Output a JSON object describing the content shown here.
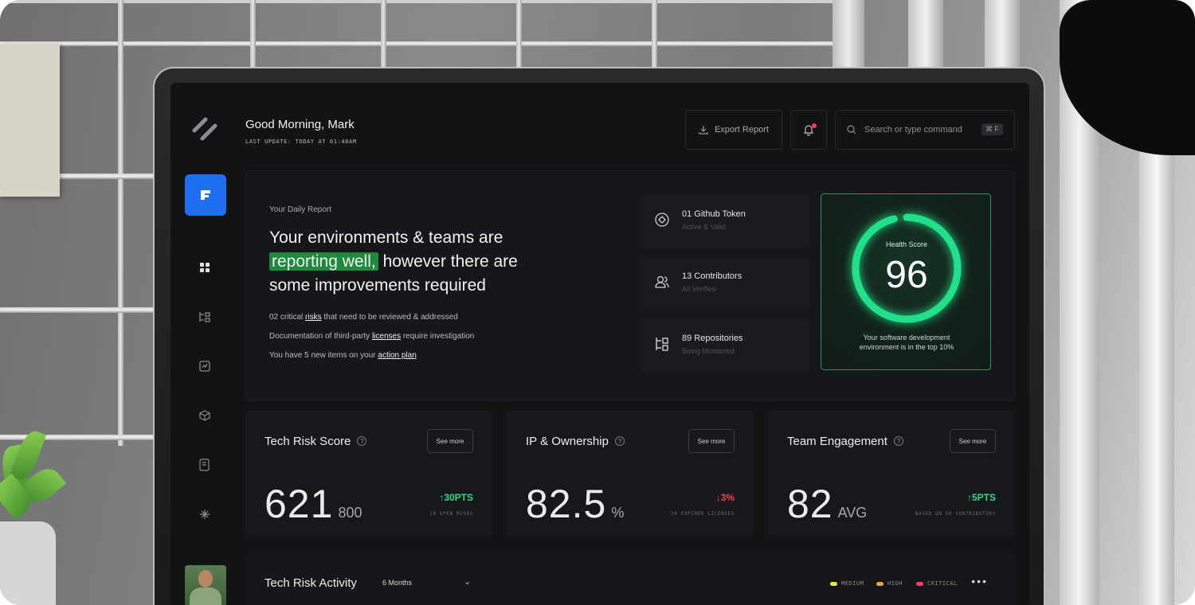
{
  "header": {
    "greeting": "Good Morning, Mark",
    "last_update": "LAST UPDATE: TODAY AT 01:48AM",
    "export_label": "Export Report",
    "search_placeholder": "Search or type command",
    "search_shortcut": "⌘ F"
  },
  "report": {
    "label": "Your Daily Report",
    "headline_pre": "Your environments & teams are",
    "headline_highlight": "reporting well,",
    "headline_post": "however there are some improvements required",
    "lines": [
      {
        "pre": "02 critical ",
        "link": "risks",
        "post": " that need to be reviewed & addressed"
      },
      {
        "pre": "Documentation of third-party ",
        "link": "licenses",
        "post": " require investigation"
      },
      {
        "pre": "You have 5 new items on your ",
        "link": "action plan",
        "post": ""
      }
    ]
  },
  "stats": [
    {
      "title": "01 Github Token",
      "subtitle": "Active & Valid",
      "icon": "token-icon"
    },
    {
      "title": "13 Contributors",
      "subtitle": "All Verified",
      "icon": "users-icon"
    },
    {
      "title": "89 Repositories",
      "subtitle": "Being Monitored",
      "icon": "repo-icon"
    }
  ],
  "health": {
    "label": "Health Score",
    "score": "96",
    "score_fraction": 0.96,
    "description": "Your software development environment is in the top 10%",
    "accent": "#22e08a"
  },
  "cards": [
    {
      "title": "Tech Risk Score",
      "more": "See more",
      "value": "621",
      "unit": "800",
      "delta": "30PTS",
      "direction": "up",
      "note": "20 OPEN RISKS"
    },
    {
      "title": "IP & Ownership",
      "more": "See more",
      "value": "82.5",
      "unit": "%",
      "delta": "3%",
      "direction": "down",
      "note": "20 EXPIRED LICENSES"
    },
    {
      "title": "Team Engagement",
      "more": "See more",
      "value": "82",
      "unit": "AVG",
      "delta": "5PTS",
      "direction": "up",
      "note": "BASED ON 50 CONTRIBUTORS"
    }
  ],
  "activity": {
    "title": "Tech Risk Activity",
    "range": "6 Months",
    "legend": [
      {
        "label": "MEDIUM",
        "color": "#e8e84a"
      },
      {
        "label": "HIGH",
        "color": "#f0a33a"
      },
      {
        "label": "CRITICAL",
        "color": "#ff3b6b"
      }
    ]
  },
  "colors": {
    "brand": "#1f6ff2",
    "positive": "#2fd98a",
    "negative": "#ff3b5c",
    "highlight": "#1f8a3e"
  }
}
